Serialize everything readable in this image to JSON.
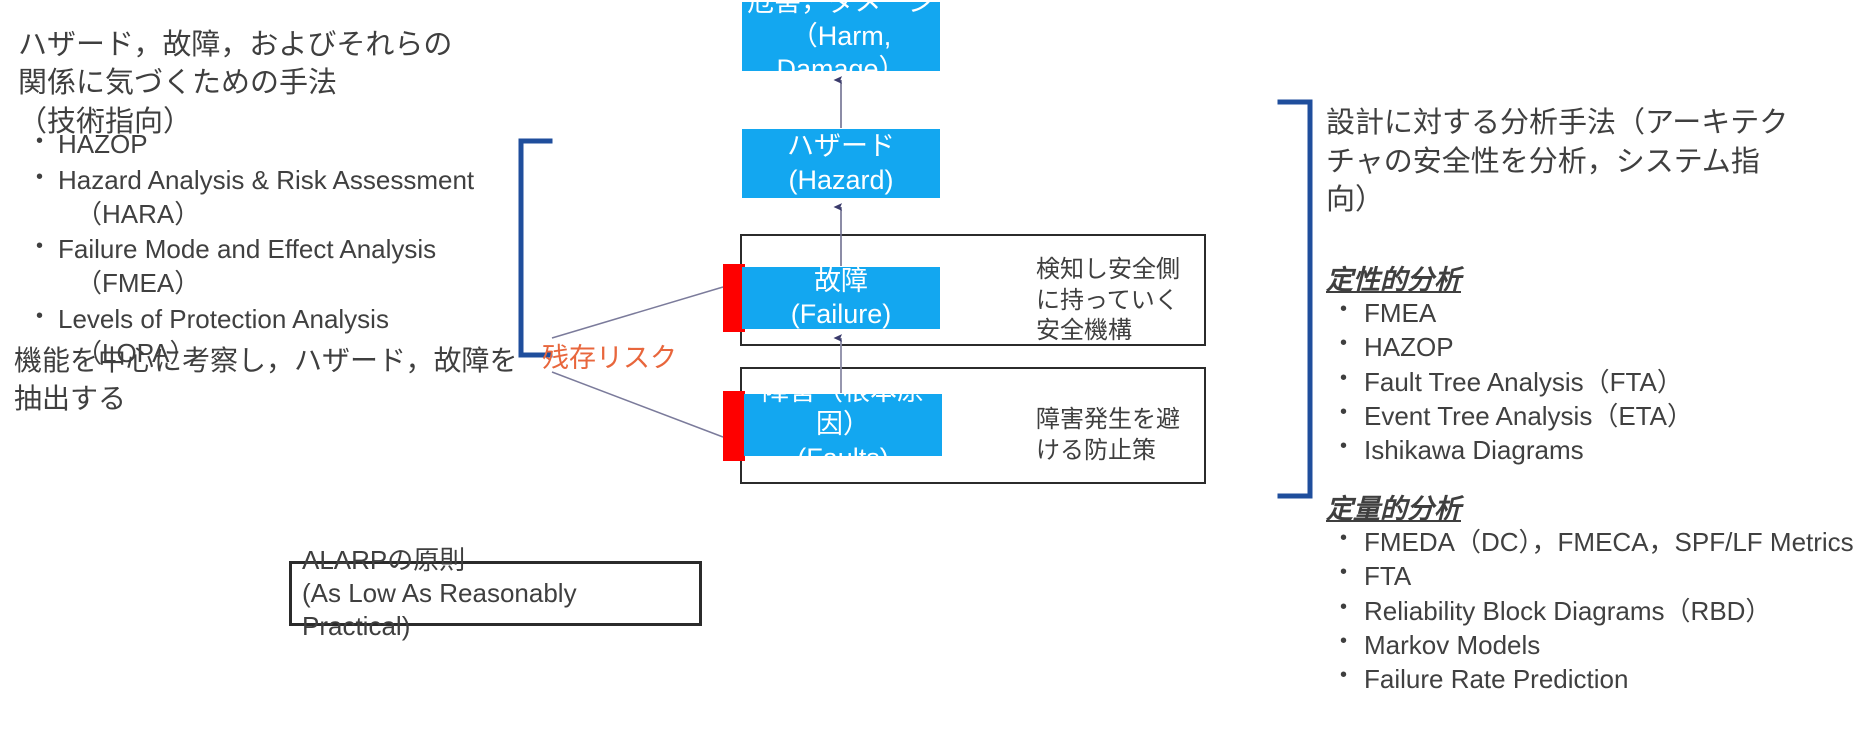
{
  "left": {
    "heading": "ハザード，故障，およびそれらの\n関係に気づくための手法\n（技術指向）",
    "bullets": [
      {
        "main": "HAZOP",
        "sub": ""
      },
      {
        "main": "Hazard Analysis & Risk Assessment",
        "sub": "（HARA）"
      },
      {
        "main": "Failure Mode and Effect Analysis",
        "sub": "（FMEA）"
      },
      {
        "main": "Levels of Protection Analysis",
        "sub": "（LOPA）"
      }
    ],
    "note": "機能を中心に考察し，ハザード，故障を\n抽出する"
  },
  "flow": {
    "harm": {
      "jp": "危害，ダメージ",
      "en": "（Harm, Damage）"
    },
    "hazard": {
      "jp": "ハザード",
      "en": "(Hazard)"
    },
    "failure": {
      "jp": "故障",
      "en": "(Failure)"
    },
    "faults": {
      "jp": "障害（根本原因）",
      "en": "(Faults)"
    },
    "detect_label": "検知し安全側に持っていく安全機構",
    "prevent_label": "障害発生を避ける防止策",
    "residual_risk": "残存リスク"
  },
  "alarp": {
    "line1": "ALARPの原則",
    "line2": "(As Low As Reasonably Practical)"
  },
  "right": {
    "heading": "設計に対する分析手法（アーキテク\nチャの安全性を分析，システム指\n向）",
    "qualitative_title": "定性的分析",
    "qualitative": [
      "FMEA",
      "HAZOP",
      "Fault Tree Analysis（FTA）",
      "Event Tree Analysis（ETA）",
      "Ishikawa Diagrams"
    ],
    "quantitative_title": "定量的分析",
    "quantitative": [
      "FMEDA（DC），FMECA，SPF/LF Metrics",
      "FTA",
      "Reliability Block Diagrams（RBD）",
      "Markov Models",
      "Failure Rate Prediction"
    ]
  },
  "colors": {
    "box_blue": "#13a7f0",
    "residual_red": "#fe0000",
    "bracket_blue": "#1f4e9c",
    "residual_text": "#e8663c",
    "outline": "#2b2b2b",
    "arrow": "#3a3a6b"
  }
}
